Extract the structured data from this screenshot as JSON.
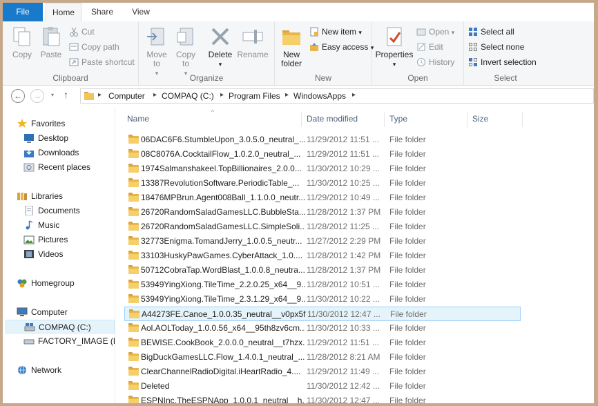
{
  "tabs": [
    {
      "label": "File"
    },
    {
      "label": "Home"
    },
    {
      "label": "Share"
    },
    {
      "label": "View"
    }
  ],
  "ribbon": {
    "clipboard": {
      "label": "Clipboard",
      "copy": "Copy",
      "paste": "Paste",
      "cut": "Cut",
      "copy_path": "Copy path",
      "paste_shortcut": "Paste shortcut"
    },
    "organize": {
      "label": "Organize",
      "move_to": "Move to",
      "copy_to": "Copy to",
      "delete": "Delete",
      "rename": "Rename"
    },
    "new": {
      "label": "New",
      "new_folder": "New folder",
      "new_item": "New item",
      "easy_access": "Easy access"
    },
    "open": {
      "label": "Open",
      "properties": "Properties",
      "open": "Open",
      "edit": "Edit",
      "history": "History"
    },
    "select": {
      "label": "Select",
      "select_all": "Select all",
      "select_none": "Select none",
      "invert_selection": "Invert selection"
    }
  },
  "address": {
    "crumbs": [
      "Computer",
      "COMPAQ (C:)",
      "Program Files",
      "WindowsApps"
    ]
  },
  "nav": {
    "favorites": "Favorites",
    "desktop": "Desktop",
    "downloads": "Downloads",
    "recent": "Recent places",
    "libraries": "Libraries",
    "documents": "Documents",
    "music": "Music",
    "pictures": "Pictures",
    "videos": "Videos",
    "homegroup": "Homegroup",
    "computer": "Computer",
    "compaq": "COMPAQ (C:)",
    "factory": "FACTORY_IMAGE (D",
    "network": "Network"
  },
  "columns": {
    "name": "Name",
    "date": "Date modified",
    "type": "Type",
    "size": "Size"
  },
  "files": [
    {
      "name": "06DAC6F6.StumbleUpon_3.0.5.0_neutral_...",
      "date": "11/29/2012 11:51 ...",
      "type": "File folder"
    },
    {
      "name": "08C8076A.CocktailFlow_1.0.2.0_neutral_...",
      "date": "11/29/2012 11:51 ...",
      "type": "File folder"
    },
    {
      "name": "1974Salmanshakeel.TopBillionaires_2.0.0...",
      "date": "11/30/2012 10:29 ...",
      "type": "File folder"
    },
    {
      "name": "13387RevolutionSoftware.PeriodicTable_...",
      "date": "11/30/2012 10:25 ...",
      "type": "File folder"
    },
    {
      "name": "18476MPBrun.Agent008Ball_1.1.0.0_neutr...",
      "date": "11/29/2012 10:49 ...",
      "type": "File folder"
    },
    {
      "name": "26720RandomSaladGamesLLC.BubbleSta...",
      "date": "11/28/2012 1:37 PM",
      "type": "File folder"
    },
    {
      "name": "26720RandomSaladGamesLLC.SimpleSoli...",
      "date": "11/28/2012 11:25 ...",
      "type": "File folder"
    },
    {
      "name": "32773Enigma.TomandJerry_1.0.0.5_neutr...",
      "date": "11/27/2012 2:29 PM",
      "type": "File folder"
    },
    {
      "name": "33103HuskyPawGames.CyberAttack_1.0....",
      "date": "11/28/2012 1:42 PM",
      "type": "File folder"
    },
    {
      "name": "50712CobraTap.WordBlast_1.0.0.8_neutra...",
      "date": "11/28/2012 1:37 PM",
      "type": "File folder"
    },
    {
      "name": "53949YingXiong.TileTime_2.2.0.25_x64__9...",
      "date": "11/28/2012 10:51 ...",
      "type": "File folder"
    },
    {
      "name": "53949YingXiong.TileTime_2.3.1.29_x64__9...",
      "date": "11/30/2012 10:22 ...",
      "type": "File folder"
    },
    {
      "name": "A44273FE.Canoe_1.0.0.35_neutral__v0px5f...",
      "date": "11/30/2012 12:47 ...",
      "type": "File folder"
    },
    {
      "name": "Aol.AOLToday_1.0.0.56_x64__95th8zv6cm...",
      "date": "11/30/2012 10:33 ...",
      "type": "File folder"
    },
    {
      "name": "BEWISE.CookBook_2.0.0.0_neutral__t7hzx...",
      "date": "11/29/2012 11:51 ...",
      "type": "File folder"
    },
    {
      "name": "BigDuckGamesLLC.Flow_1.4.0.1_neutral_...",
      "date": "11/28/2012 8:21 AM",
      "type": "File folder"
    },
    {
      "name": "ClearChannelRadioDigital.iHeartRadio_4....",
      "date": "11/29/2012 11:49 ...",
      "type": "File folder"
    },
    {
      "name": "Deleted",
      "date": "11/30/2012 12:42 ...",
      "type": "File folder"
    },
    {
      "name": "ESPNInc.TheESPNApp_1.0.0.1_neutral__h...",
      "date": "11/30/2012 12:47 ...",
      "type": "File folder"
    }
  ],
  "selected_index": 12
}
